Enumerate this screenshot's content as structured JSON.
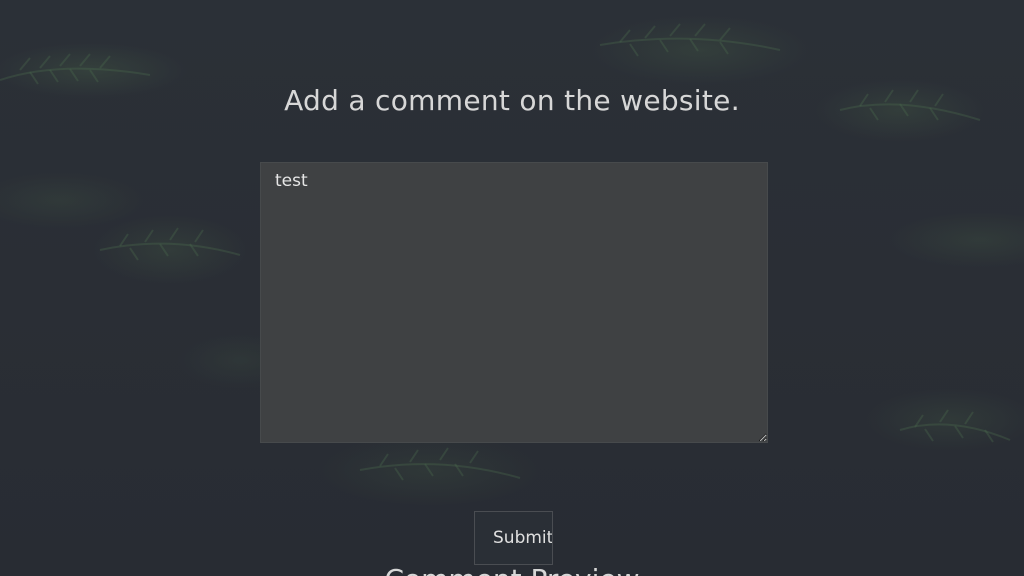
{
  "page": {
    "heading": "Add a comment on the website.",
    "comment_value": "test",
    "submit_label": "Submit",
    "section_title": "Comment Preview"
  },
  "colors": {
    "background": "#2a2f36",
    "textarea_bg": "#3f4143",
    "text": "#d7d7d7"
  },
  "background_image": "dark-pine-branches"
}
